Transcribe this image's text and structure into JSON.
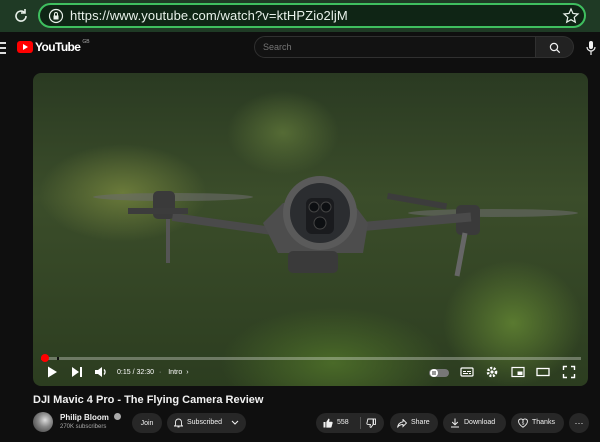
{
  "browser": {
    "url": "https://www.youtube.com/watch?v=ktHPZio2ljM"
  },
  "header": {
    "logo_text": "YouTube",
    "region": "GB",
    "search_placeholder": "Search"
  },
  "player": {
    "time": "0:15 / 32:30",
    "chapter": "Intro",
    "progress_fraction": 0.008,
    "chapter_marker_fraction": 0.03
  },
  "video": {
    "title": "DJI Mavic 4 Pro - The Flying Camera Review"
  },
  "channel": {
    "name": "Philip Bloom",
    "subscribers": "270K subscribers"
  },
  "actions": {
    "join": "Join",
    "subscribed": "Subscribed",
    "likes": "558",
    "share": "Share",
    "download": "Download",
    "thanks": "Thanks",
    "more": "···"
  },
  "colors": {
    "accent": "#ff0000",
    "browser_bar": "#1f3a25",
    "url_border": "#3fbf5f"
  }
}
